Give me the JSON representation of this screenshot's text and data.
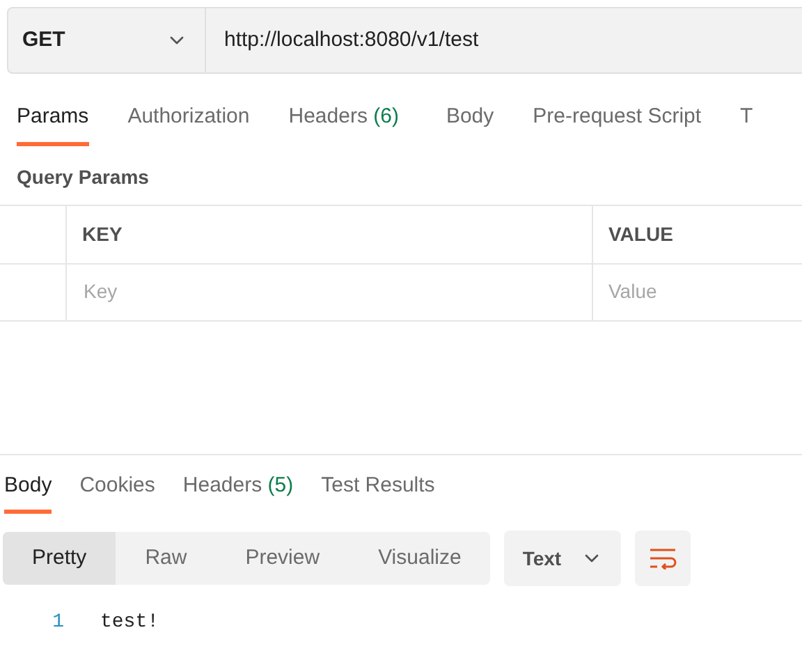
{
  "request": {
    "method": "GET",
    "url": "http://localhost:8080/v1/test"
  },
  "request_tabs": [
    {
      "label": "Params",
      "selected": true
    },
    {
      "label": "Authorization",
      "selected": false
    },
    {
      "label": "Headers",
      "count": "(6)",
      "selected": false
    },
    {
      "label": "Body",
      "selected": false
    },
    {
      "label": "Pre-request Script",
      "selected": false
    },
    {
      "label": "T",
      "selected": false
    }
  ],
  "query_params": {
    "title": "Query Params",
    "columns": [
      "KEY",
      "VALUE"
    ],
    "row": {
      "key_placeholder": "Key",
      "value_placeholder": "Value"
    }
  },
  "response_tabs": [
    {
      "label": "Body",
      "selected": true
    },
    {
      "label": "Cookies",
      "selected": false
    },
    {
      "label": "Headers",
      "count": "(5)",
      "selected": false
    },
    {
      "label": "Test Results",
      "selected": false
    }
  ],
  "view_modes": [
    {
      "label": "Pretty",
      "selected": true
    },
    {
      "label": "Raw",
      "selected": false
    },
    {
      "label": "Preview",
      "selected": false
    },
    {
      "label": "Visualize",
      "selected": false
    }
  ],
  "format": "Text",
  "code_lines": [
    {
      "number": "1",
      "text": "test!"
    }
  ]
}
